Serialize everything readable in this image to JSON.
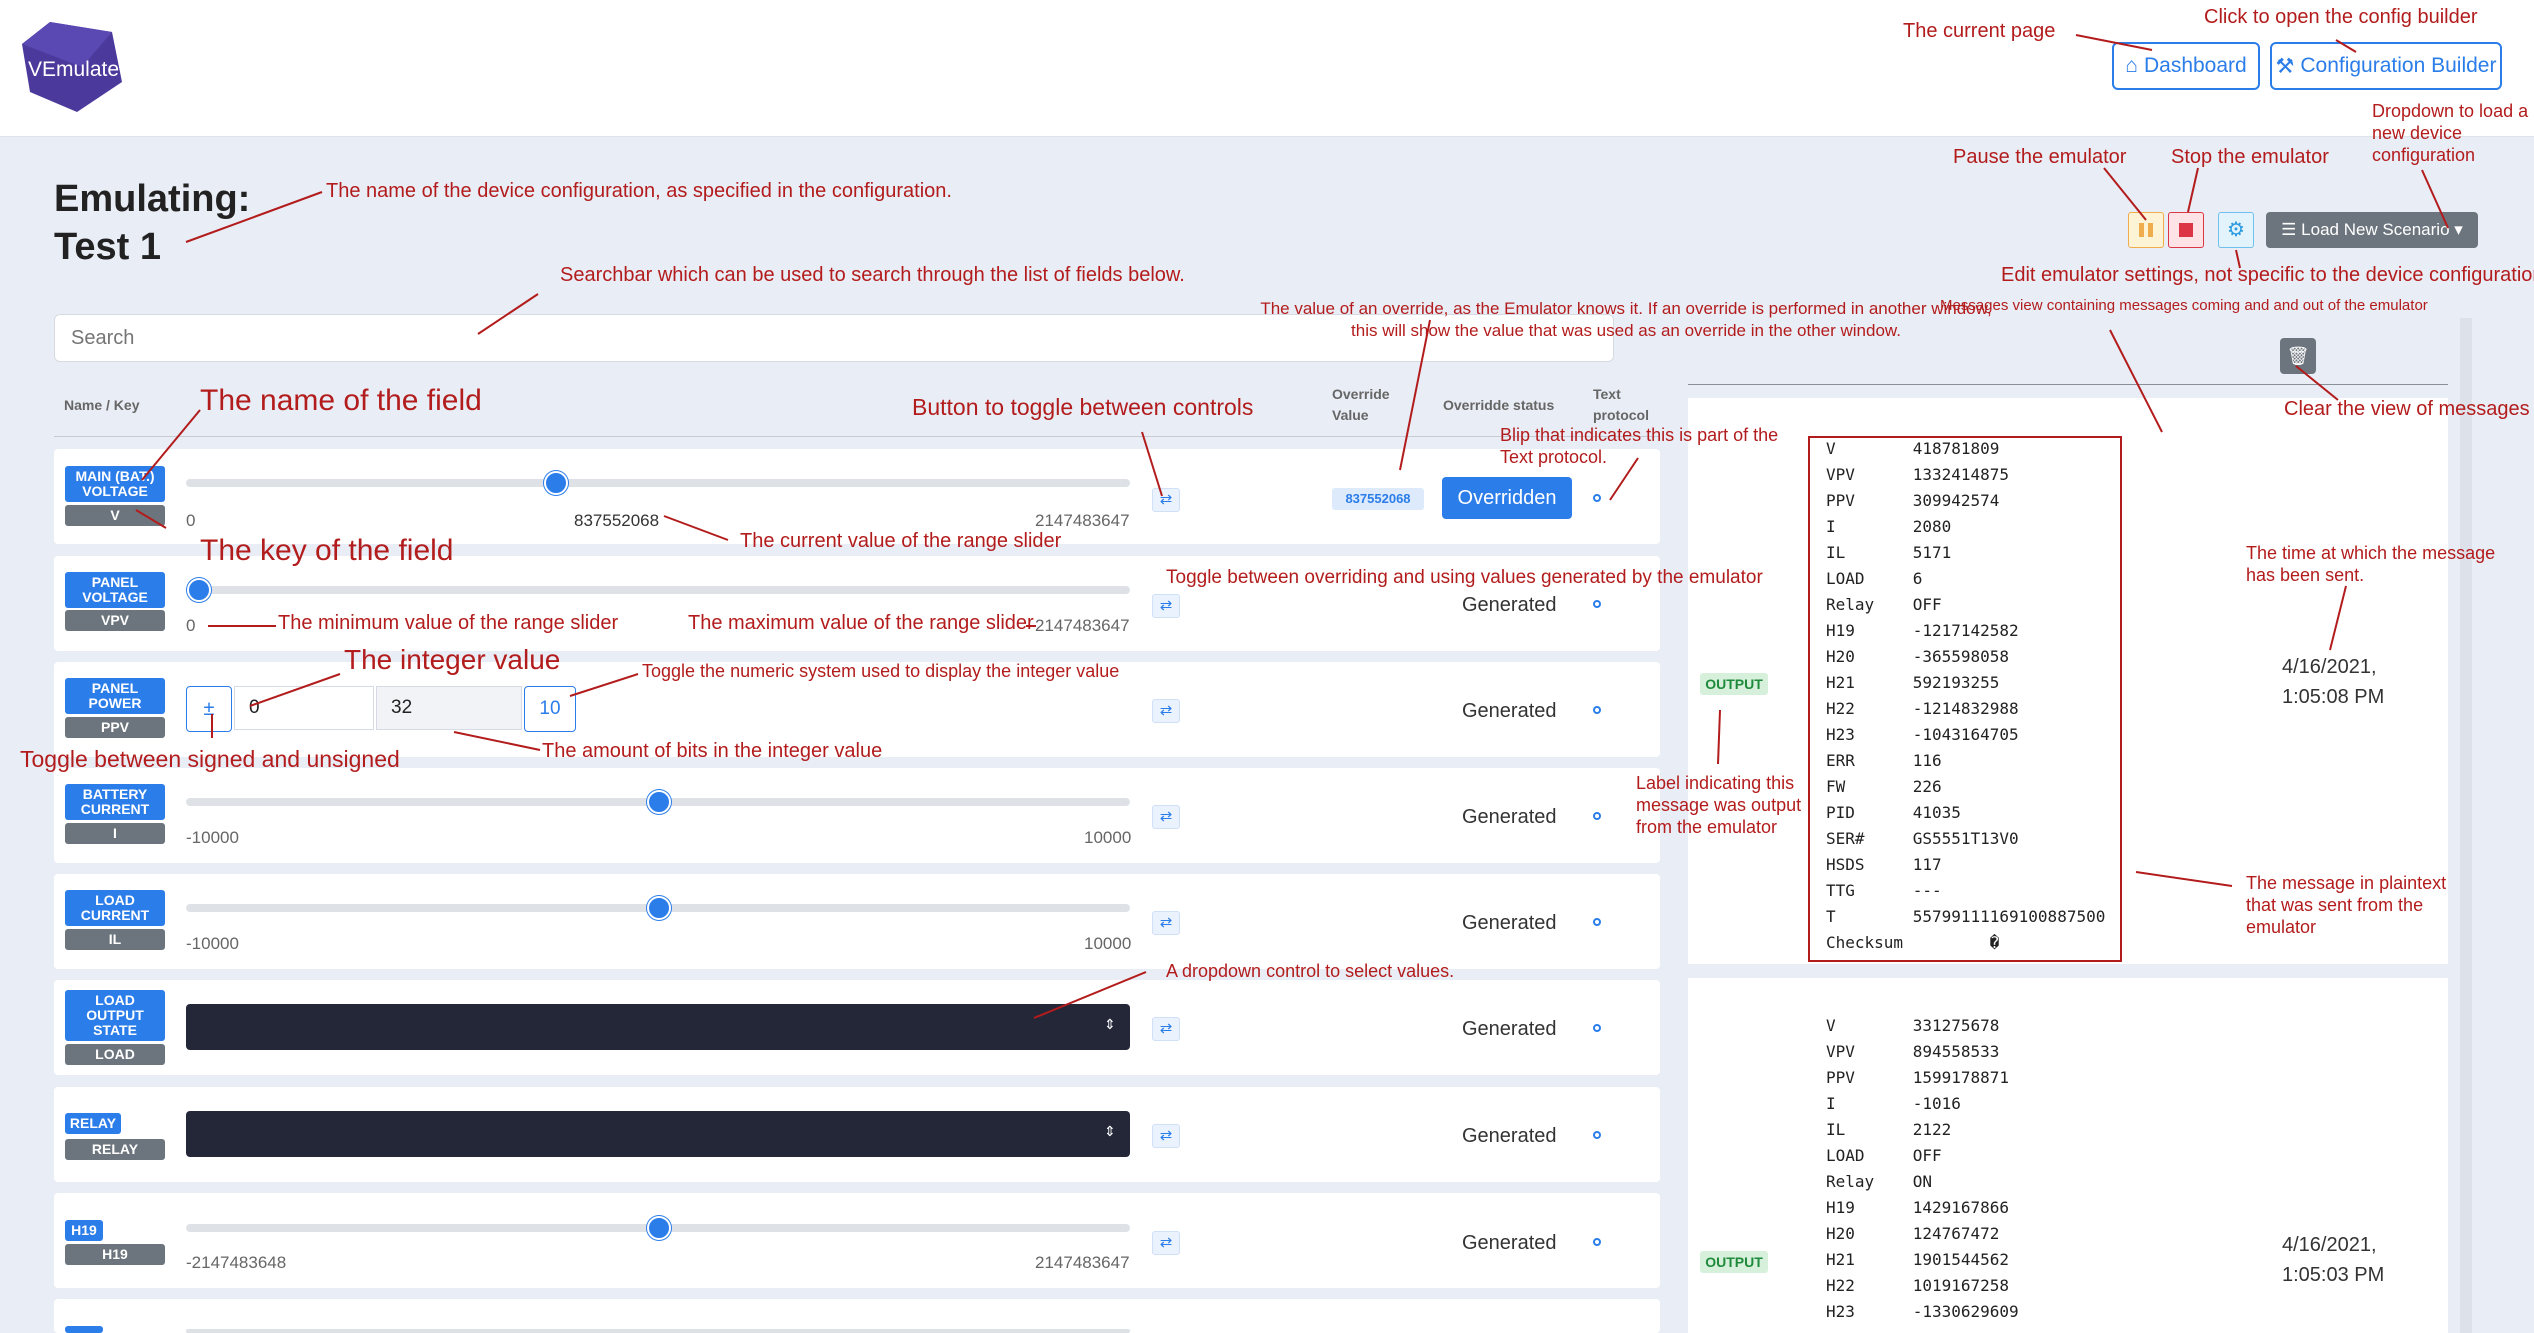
{
  "header": {
    "logo_text": "VEmulate",
    "dashboard_label": "Dashboard",
    "config_builder_label": "Configuration Builder"
  },
  "page": {
    "title_line1": "Emulating:",
    "title_line2": "Test 1",
    "search_placeholder": "Search",
    "load_scenario_label": "Load New Scenario"
  },
  "table_headers": {
    "name_key": "Name / Key",
    "override_value": "Override Value",
    "override_status": "Overridde status",
    "text_protocol": "Text protocol"
  },
  "fields": [
    {
      "name": "MAIN (BAT.) VOLTAGE",
      "key": "V",
      "min": "0",
      "max": "2147483647",
      "current": "837552068",
      "override_value": "837552068",
      "status": "Overridden",
      "slider_fraction": 0.39
    },
    {
      "name": "PANEL VOLTAGE",
      "key": "VPV",
      "min": "0",
      "max": "2147483647",
      "status": "Generated",
      "slider_fraction": 0.01
    },
    {
      "name": "PANEL POWER",
      "key": "PPV",
      "sign_toggle": "±",
      "int_value": "0",
      "bits": "32",
      "base": "10",
      "status": "Generated"
    },
    {
      "name": "BATTERY CURRENT",
      "key": "I",
      "min": "-10000",
      "max": "10000",
      "status": "Generated",
      "slider_fraction": 0.5
    },
    {
      "name": "LOAD CURRENT",
      "key": "IL",
      "min": "-10000",
      "max": "10000",
      "status": "Generated",
      "slider_fraction": 0.5
    },
    {
      "name": "LOAD OUTPUT STATE",
      "key": "LOAD",
      "status": "Generated"
    },
    {
      "name": "RELAY",
      "key": "RELAY",
      "status": "Generated"
    },
    {
      "name": "H19",
      "key": "H19",
      "min": "-2147483648",
      "max": "2147483647",
      "status": "Generated",
      "slider_fraction": 0.5
    }
  ],
  "messages": [
    {
      "label": "OUTPUT",
      "time_line1": "4/16/2021,",
      "time_line2": "1:05:08 PM",
      "lines": [
        "V        418781809",
        "VPV      1332414875",
        "PPV      309942574",
        "I        2080",
        "IL       5171",
        "LOAD     6",
        "Relay    OFF",
        "H19      -1217142582",
        "H20      -365598058",
        "H21      592193255",
        "H22      -1214832988",
        "H23      -1043164705",
        "ERR      116",
        "FW       226",
        "PID      41035",
        "SER#     GS5551T13V0",
        "HSDS     117",
        "TTG      ---",
        "T        55799111169100887500",
        "Checksum         �"
      ]
    },
    {
      "label": "OUTPUT",
      "time_line1": "4/16/2021,",
      "time_line2": "1:05:03 PM",
      "lines": [
        "V        331275678",
        "VPV      894558533",
        "PPV      1599178871",
        "I        -1016",
        "IL       2122",
        "LOAD     OFF",
        "Relay    ON",
        "H19      1429167866",
        "H20      124767472",
        "H21      1901544562",
        "H22      1019167258",
        "H23      -1330629609"
      ]
    }
  ],
  "annotations": {
    "current_page": "The current page",
    "config_builder": "Click to open the config builder",
    "load_dropdown": "Dropdown to load a new device configuration",
    "pause": "Pause the emulator",
    "stop": "Stop the emulator",
    "device_name": "The name of the device configuration, as specified in the configuration.",
    "settings": "Edit emulator settings, not specific to the device  configuration",
    "searchbar": "Searchbar which can be used to search through the list of fields below.",
    "override_value": "The value of an override, as the Emulator knows it. If an override is performed in another window, this will show the value that was used as an override in the other window.",
    "messages_view": "Messages view containing messages coming and and out of the emulator",
    "field_name": "The name of the field",
    "toggle_controls": "Button to toggle between controls",
    "blip": "Blip that indicates this is part of the Text protocol.",
    "clear_messages": "Clear the view of messages",
    "field_key": "The key of the field",
    "current_value": "The current value of the range slider",
    "toggle_override": "Toggle between overriding and using values generated by the emulator",
    "min_value": "The minimum value of the range slider",
    "max_value": "The maximum value of the range slider",
    "time_sent": "The time at which the message has been sent.",
    "integer_value": "The integer value",
    "numeric_system": "Toggle the numeric system used to display the integer value",
    "signed_toggle": "Toggle between signed and unsigned",
    "bits": "The amount of bits in the integer value",
    "output_label": "Label indicating this message was output from the emulator",
    "plaintext": "The message in plaintext that was sent from the emulator",
    "dropdown": "A dropdown control to select values."
  },
  "colors": {
    "primary": "#2b7de9",
    "annotation": "#b31c1c",
    "pause": "#f0ad4e",
    "stop": "#dc3545",
    "dark_select": "#232738"
  }
}
